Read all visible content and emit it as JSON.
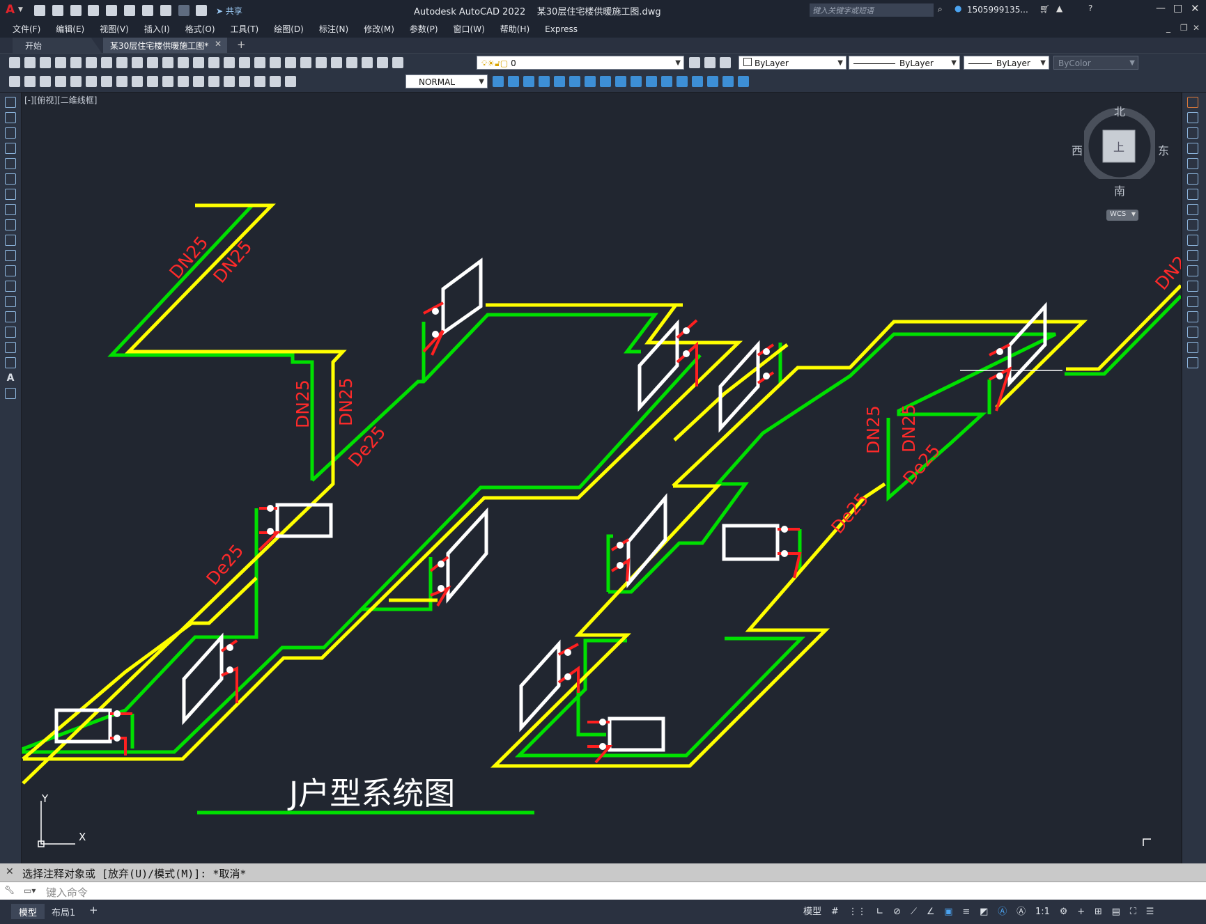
{
  "window": {
    "app_logo": "A",
    "title": "Autodesk AutoCAD 2022    某30层住宅楼供暖施工图.dwg",
    "search_placeholder": "键入关键字或短语",
    "user": "1505999135...",
    "share": "共享",
    "controls": [
      "minimize",
      "maximize",
      "close"
    ]
  },
  "menu": [
    "文件(F)",
    "编辑(E)",
    "视图(V)",
    "插入(I)",
    "格式(O)",
    "工具(T)",
    "绘图(D)",
    "标注(N)",
    "修改(M)",
    "参数(P)",
    "窗口(W)",
    "帮助(H)",
    "Express"
  ],
  "tabs": {
    "start": "开始",
    "active": "某30层住宅楼供暖施工图*"
  },
  "toolbar": {
    "layer_value": "0",
    "color_value": "ByLayer",
    "linetype_value": "ByLayer",
    "lineweight_value": "ByLayer",
    "plotstyle_value": "ByColor",
    "style_value": "NORMAL"
  },
  "viewport": {
    "label": "[-][俯视][二维线框]",
    "compass": {
      "north": "北",
      "south": "南",
      "west": "西",
      "east": "东",
      "center": "上",
      "wcs": "WCS"
    },
    "ucs": {
      "x": "X",
      "y": "Y"
    }
  },
  "drawing": {
    "labels": [
      "DN25",
      "DN25",
      "DN25",
      "DN25",
      "De25",
      "De25",
      "DN25",
      "DN25",
      "De25",
      "De25",
      "DN2"
    ],
    "title": "J户型系统图",
    "colors": {
      "supply": "#ffff00",
      "return": "#00e000",
      "valve": "#ff2020",
      "radiator": "#ffffff",
      "text": "#ff2a2a"
    }
  },
  "command": {
    "history": "选择注释对象或 [放弃(U)/模式(M)]: *取消*",
    "placeholder": "键入命令"
  },
  "status": {
    "layout_tabs": [
      "模型",
      "布局1"
    ],
    "model_btn": "模型",
    "scale": "1:1"
  }
}
